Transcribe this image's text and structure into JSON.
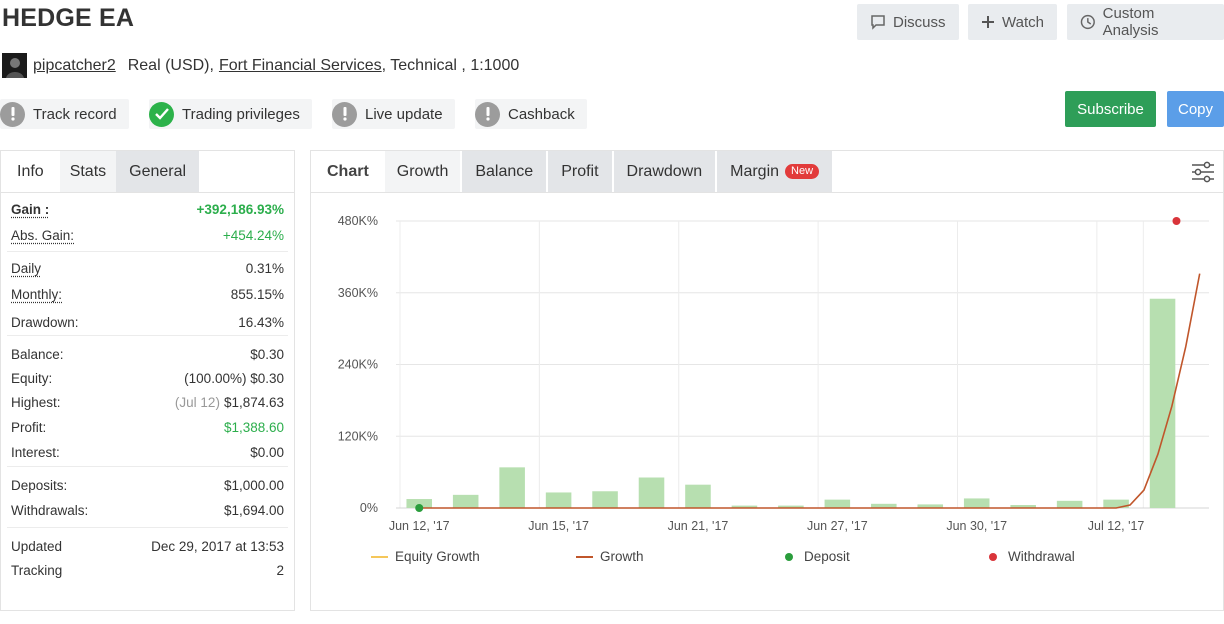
{
  "header": {
    "title": "HEDGE EA",
    "discuss_label": "Discuss",
    "watch_label": "Watch",
    "custom_analysis_label": "Custom Analysis"
  },
  "account": {
    "username": "pipcatcher2",
    "type": "Real (USD),",
    "broker": "Fort Financial Services",
    "details": ", Technical , 1:1000"
  },
  "badges": [
    "Track record",
    "Trading privileges",
    "Live update",
    "Cashback"
  ],
  "actions": {
    "subscribe_label": "Subscribe",
    "copy_label": "Copy"
  },
  "left_tabs": [
    "Info",
    "Stats",
    "General"
  ],
  "stats": {
    "gain": {
      "label": "Gain :",
      "value": "+392,186.93%"
    },
    "abs_gain": {
      "label": "Abs. Gain:",
      "value": "+454.24%"
    },
    "daily": {
      "label": "Daily",
      "value": "0.31%"
    },
    "monthly": {
      "label": "Monthly:",
      "value": "855.15%"
    },
    "drawdown": {
      "label": "Drawdown:",
      "value": "16.43%"
    },
    "balance": {
      "label": "Balance:",
      "value": "$0.30"
    },
    "equity": {
      "label": "Equity:",
      "value": "(100.00%) $0.30"
    },
    "highest": {
      "label": "Highest:",
      "note": "(Jul 12)",
      "value": "$1,874.63"
    },
    "profit": {
      "label": "Profit:",
      "value": "$1,388.60"
    },
    "interest": {
      "label": "Interest:",
      "value": "$0.00"
    },
    "deposits": {
      "label": "Deposits:",
      "value": "$1,000.00"
    },
    "withdrawals": {
      "label": "Withdrawals:",
      "value": "$1,694.00"
    },
    "updated": {
      "label": "Updated",
      "value": "Dec 29, 2017 at 13:53"
    },
    "tracking": {
      "label": "Tracking",
      "value": "2"
    }
  },
  "chart_tabs": {
    "chart": "Chart",
    "growth": "Growth",
    "balance": "Balance",
    "profit": "Profit",
    "drawdown": "Drawdown",
    "margin": "Margin",
    "new_badge": "New"
  },
  "colors": {
    "green_text": "#2cae4c",
    "bar_fill": "#b7dfb0",
    "growth_line": "#c0562b",
    "equity_line": "#f5c75a",
    "deposit_dot": "#2a9d3c",
    "withdrawal_dot": "#d9343a",
    "subscribe_bg": "#2e9e58",
    "copy_bg": "#5b9ee8"
  },
  "chart_data": {
    "type": "bar",
    "ylabels": [
      "480K%",
      "360K%",
      "240K%",
      "120K%",
      "0%"
    ],
    "ylim": [
      0,
      480000
    ],
    "xlabels": [
      "Jun 12, '17",
      "Jun 15, '17",
      "Jun 21, '17",
      "Jun 27, '17",
      "Jun 30, '17",
      "Jul 12, '17"
    ],
    "bar_values": [
      15000,
      22000,
      68000,
      26000,
      28000,
      51000,
      39000,
      4000,
      4000,
      14000,
      7000,
      6000,
      16000,
      5000,
      12000,
      14000,
      350000
    ],
    "growth_line": [
      [
        0,
        0
      ],
      [
        15,
        0
      ],
      [
        15.3,
        5000
      ],
      [
        15.6,
        30000
      ],
      [
        15.9,
        90000
      ],
      [
        16.2,
        170000
      ],
      [
        16.5,
        270000
      ],
      [
        16.8,
        392000
      ]
    ],
    "deposit_point": {
      "x": 0,
      "y": 0
    },
    "withdrawal_point": {
      "x": 16.3,
      "y": 480000
    },
    "legend": [
      "Equity Growth",
      "Growth",
      "Deposit",
      "Withdrawal"
    ]
  }
}
